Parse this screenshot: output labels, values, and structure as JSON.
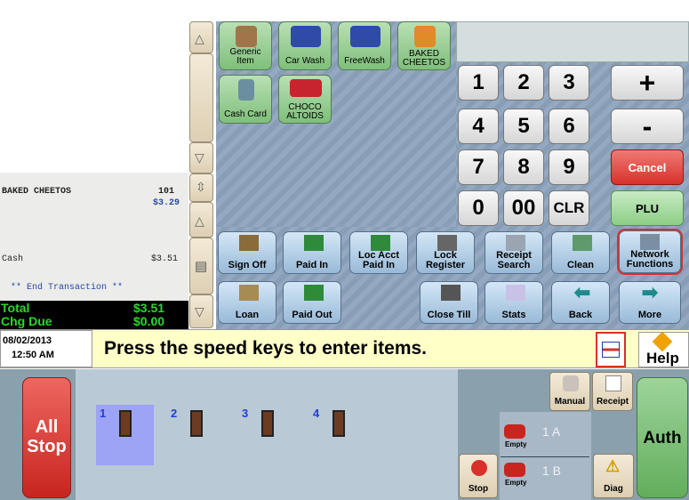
{
  "items": [
    {
      "label_line1": "Generic",
      "label_line2": "Item"
    },
    {
      "label_line1": "Car Wash",
      "label_line2": ""
    },
    {
      "label_line1": "FreeWash",
      "label_line2": ""
    },
    {
      "label_line1": "BAKED",
      "label_line2": "CHEETOS"
    },
    {
      "label_line1": "Cash Card",
      "label_line2": ""
    },
    {
      "label_line1": "CHOCO",
      "label_line2": "ALTOIDS"
    }
  ],
  "keypad": {
    "k1": "1",
    "k2": "2",
    "k3": "3",
    "plus": "+",
    "k4": "4",
    "k5": "5",
    "k6": "6",
    "minus": "-",
    "k7": "7",
    "k8": "8",
    "k9": "9",
    "cancel": "Cancel",
    "k0": "0",
    "k00": "00",
    "clr": "CLR",
    "plu": "PLU"
  },
  "receipt": {
    "item_name": "BAKED CHEETOS",
    "item_qty": "101",
    "item_price": "$3.29",
    "payment_label": "Cash",
    "payment_amount": "$3.51",
    "end_transaction": "** End Transaction **",
    "total_label": "Total",
    "total_value": "$3.51",
    "chg_due_label": "Chg Due",
    "chg_due_value": "$0.00"
  },
  "functions": {
    "sign_off": "Sign Off",
    "paid_in": "Paid In",
    "loc_acct_1": "Loc Acct",
    "loc_acct_2": "Paid In",
    "lock_1": "Lock",
    "lock_2": "Register",
    "receipt_search_1": "Receipt",
    "receipt_search_2": "Search",
    "clean": "Clean",
    "network_1": "Network",
    "network_2": "Functions",
    "loan": "Loan",
    "paid_out": "Paid Out",
    "close_till": "Close Till",
    "stats": "Stats",
    "back": "Back",
    "more": "More"
  },
  "status": {
    "date": "08/02/2013",
    "time": "12:50 AM",
    "message": "Press the speed keys to enter items.",
    "help": "Help"
  },
  "fuel": {
    "all_stop_1": "All",
    "all_stop_2": "Stop",
    "pumps": [
      "1",
      "2",
      "3",
      "4"
    ],
    "manual": "Manual",
    "receipt": "Receipt",
    "auth": "Auth",
    "stop": "Stop",
    "diag": "Diag",
    "empty_a": "Empty",
    "empty_b": "Empty",
    "pos_a": "1 A",
    "pos_b": "1 B"
  },
  "colors": {
    "accent_red": "#d9302a",
    "status_yellow": "#ffffc8",
    "key_green": "#7fbf7a"
  }
}
